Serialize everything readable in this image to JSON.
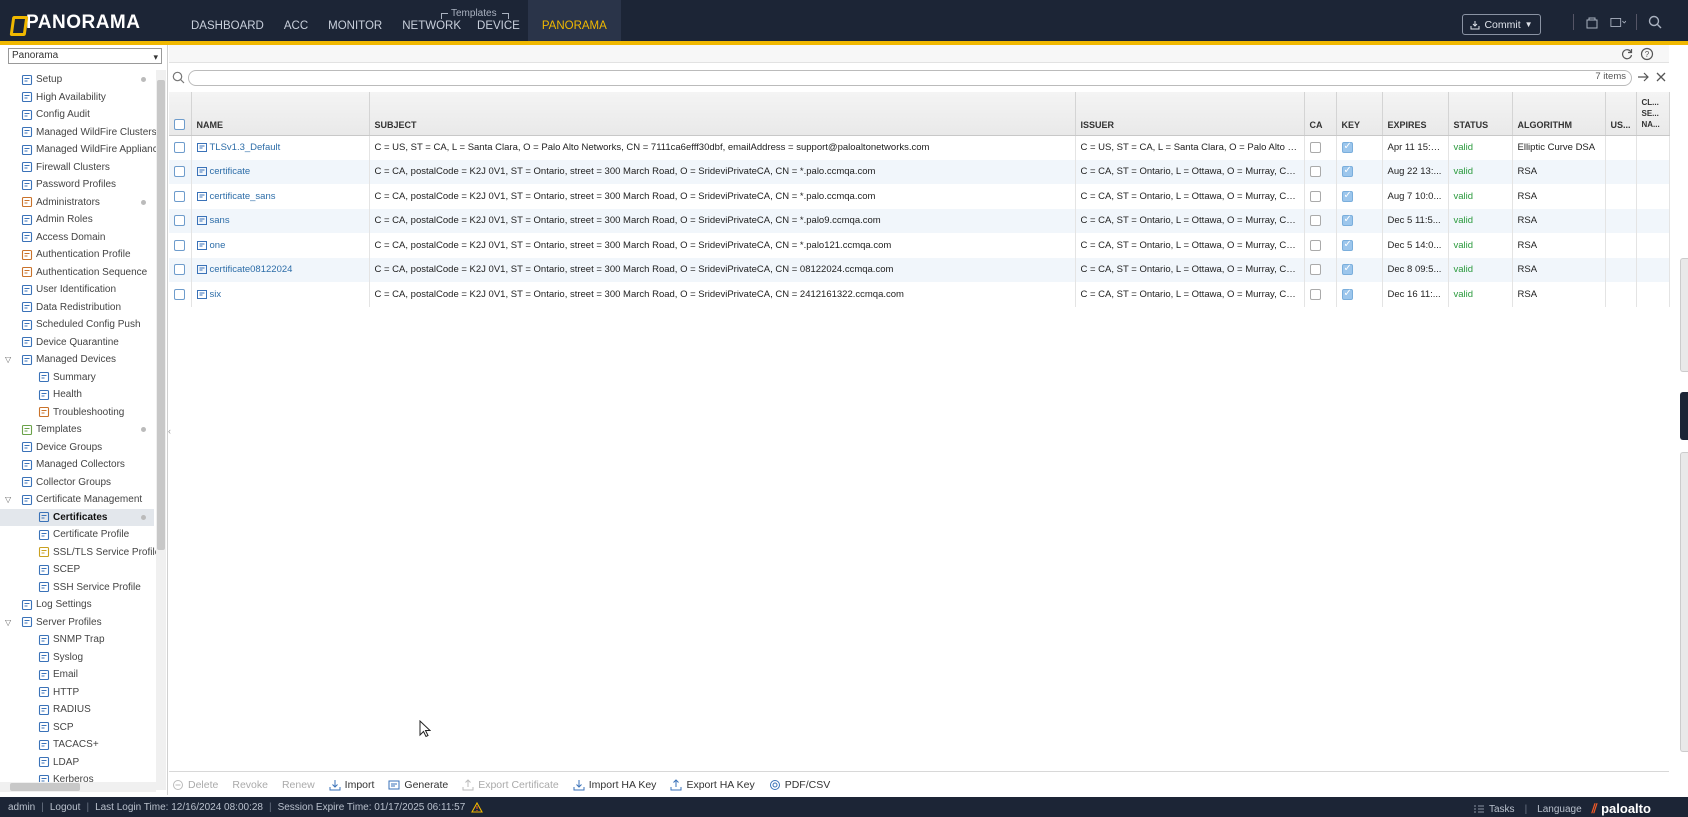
{
  "app": {
    "brand": "PANORAMA",
    "vendor": "paloalto"
  },
  "nav": {
    "tabs": [
      {
        "label": "DASHBOARD"
      },
      {
        "label": "ACC"
      },
      {
        "label": "MONITOR"
      },
      {
        "label": "NETWORK"
      },
      {
        "label": "DEVICE"
      },
      {
        "label": "PANORAMA"
      }
    ],
    "active_tab": "PANORAMA",
    "templates_group_label": "Templates",
    "commit_label": "Commit"
  },
  "context_select": {
    "value": "Panorama"
  },
  "sidebar": {
    "items": [
      {
        "label": "Setup",
        "icon": "setup-icon",
        "dot": true
      },
      {
        "label": "High Availability",
        "icon": "ha-icon"
      },
      {
        "label": "Config Audit",
        "icon": "audit-icon"
      },
      {
        "label": "Managed WildFire Clusters",
        "icon": "wildfire-icon"
      },
      {
        "label": "Managed WildFire Applianc",
        "icon": "wildfire-icon"
      },
      {
        "label": "Firewall Clusters",
        "icon": "cluster-icon"
      },
      {
        "label": "Password Profiles",
        "icon": "password-icon"
      },
      {
        "label": "Administrators",
        "icon": "admin-icon",
        "dot": true
      },
      {
        "label": "Admin Roles",
        "icon": "role-icon"
      },
      {
        "label": "Access Domain",
        "icon": "domain-icon"
      },
      {
        "label": "Authentication Profile",
        "icon": "auth-icon"
      },
      {
        "label": "Authentication Sequence",
        "icon": "auth-seq-icon"
      },
      {
        "label": "User Identification",
        "icon": "user-id-icon"
      },
      {
        "label": "Data Redistribution",
        "icon": "redistribution-icon"
      },
      {
        "label": "Scheduled Config Push",
        "icon": "schedule-icon"
      },
      {
        "label": "Device Quarantine",
        "icon": "quarantine-icon"
      },
      {
        "label": "Managed Devices",
        "icon": "devices-icon",
        "expander": true
      },
      {
        "label": "Summary",
        "icon": "summary-icon",
        "indent": 1
      },
      {
        "label": "Health",
        "icon": "health-icon",
        "indent": 1
      },
      {
        "label": "Troubleshooting",
        "icon": "troubleshoot-icon",
        "indent": 1
      },
      {
        "label": "Templates",
        "icon": "templates-icon",
        "dot": true
      },
      {
        "label": "Device Groups",
        "icon": "device-groups-icon"
      },
      {
        "label": "Managed Collectors",
        "icon": "collectors-icon"
      },
      {
        "label": "Collector Groups",
        "icon": "collector-groups-icon"
      },
      {
        "label": "Certificate Management",
        "icon": "cert-mgmt-icon",
        "expander": true
      },
      {
        "label": "Certificates",
        "icon": "certificate-icon",
        "indent": 1,
        "selected": true,
        "dot": true
      },
      {
        "label": "Certificate Profile",
        "icon": "cert-profile-icon",
        "indent": 1
      },
      {
        "label": "SSL/TLS Service Profile",
        "icon": "lock-icon",
        "indent": 1
      },
      {
        "label": "SCEP",
        "icon": "scep-icon",
        "indent": 1
      },
      {
        "label": "SSH Service Profile",
        "icon": "ssh-icon",
        "indent": 1
      },
      {
        "label": "Log Settings",
        "icon": "log-icon"
      },
      {
        "label": "Server Profiles",
        "icon": "server-icon",
        "expander": true
      },
      {
        "label": "SNMP Trap",
        "icon": "snmp-icon",
        "indent": 1
      },
      {
        "label": "Syslog",
        "icon": "syslog-icon",
        "indent": 1
      },
      {
        "label": "Email",
        "icon": "email-icon",
        "indent": 1
      },
      {
        "label": "HTTP",
        "icon": "http-icon",
        "indent": 1
      },
      {
        "label": "RADIUS",
        "icon": "radius-icon",
        "indent": 1
      },
      {
        "label": "SCP",
        "icon": "scp-icon",
        "indent": 1
      },
      {
        "label": "TACACS+",
        "icon": "tacacs-icon",
        "indent": 1
      },
      {
        "label": "LDAP",
        "icon": "ldap-icon",
        "indent": 1
      },
      {
        "label": "Kerberos",
        "icon": "kerberos-icon",
        "indent": 1
      }
    ]
  },
  "search": {
    "placeholder": "",
    "items_count": "7 items"
  },
  "table": {
    "columns": [
      "NAME",
      "SUBJECT",
      "ISSUER",
      "CA",
      "KEY",
      "EXPIRES",
      "STATUS",
      "ALGORITHM",
      "US...",
      "CL... SE... NA..."
    ],
    "rows": [
      {
        "name": "TLSv1.3_Default",
        "subject": "C = US, ST = CA, L = Santa Clara, O = Palo Alto Networks, CN = 7111ca6efff30dbf, emailAddress = support@paloaltonetworks.com",
        "issuer": "C = US, ST = CA, L = Santa Clara, O = Palo Alto Ne...",
        "ca": false,
        "key": true,
        "expires": "Apr 11 15:2...",
        "status": "valid",
        "algorithm": "Elliptic Curve DSA"
      },
      {
        "name": "certificate",
        "subject": "C = CA, postalCode = K2J 0V1, ST = Ontario, street = 300 March Road, O = SrideviPrivateCA, CN = *.palo.ccmqa.com",
        "issuer": "C = CA, ST = Ontario, L = Ottawa, O = Murray, CN ...",
        "ca": false,
        "key": true,
        "expires": "Aug 22 13:...",
        "status": "valid",
        "algorithm": "RSA"
      },
      {
        "name": "certificate_sans",
        "subject": "C = CA, postalCode = K2J 0V1, ST = Ontario, street = 300 March Road, O = SrideviPrivateCA, CN = *.palo.ccmqa.com",
        "issuer": "C = CA, ST = Ontario, L = Ottawa, O = Murray, CN ...",
        "ca": false,
        "key": true,
        "expires": "Aug 7 10:0...",
        "status": "valid",
        "algorithm": "RSA"
      },
      {
        "name": "sans",
        "subject": "C = CA, postalCode = K2J 0V1, ST = Ontario, street = 300 March Road, O = SrideviPrivateCA, CN = *.palo9.ccmqa.com",
        "issuer": "C = CA, ST = Ontario, L = Ottawa, O = Murray, CN ...",
        "ca": false,
        "key": true,
        "expires": "Dec 5 11:5...",
        "status": "valid",
        "algorithm": "RSA"
      },
      {
        "name": "one",
        "subject": "C = CA, postalCode = K2J 0V1, ST = Ontario, street = 300 March Road, O = SrideviPrivateCA, CN = *.palo121.ccmqa.com",
        "issuer": "C = CA, ST = Ontario, L = Ottawa, O = Murray, CN ...",
        "ca": false,
        "key": true,
        "expires": "Dec 5 14:0...",
        "status": "valid",
        "algorithm": "RSA"
      },
      {
        "name": "certificate08122024",
        "subject": "C = CA, postalCode = K2J 0V1, ST = Ontario, street = 300 March Road, O = SrideviPrivateCA, CN = 08122024.ccmqa.com",
        "issuer": "C = CA, ST = Ontario, L = Ottawa, O = Murray, CN ...",
        "ca": false,
        "key": true,
        "expires": "Dec 8 09:5...",
        "status": "valid",
        "algorithm": "RSA"
      },
      {
        "name": "six",
        "subject": "C = CA, postalCode = K2J 0V1, ST = Ontario, street = 300 March Road, O = SrideviPrivateCA, CN = 2412161322.ccmqa.com",
        "issuer": "C = CA, ST = Ontario, L = Ottawa, O = Murray, CN ...",
        "ca": false,
        "key": true,
        "expires": "Dec 16 11:...",
        "status": "valid",
        "algorithm": "RSA"
      }
    ]
  },
  "actions": [
    {
      "label": "Delete",
      "icon": "delete-icon",
      "enabled": false
    },
    {
      "label": "Revoke",
      "icon": "",
      "enabled": false
    },
    {
      "label": "Renew",
      "icon": "",
      "enabled": false
    },
    {
      "label": "Import",
      "icon": "import-icon",
      "enabled": true
    },
    {
      "label": "Generate",
      "icon": "generate-icon",
      "enabled": true
    },
    {
      "label": "Export Certificate",
      "icon": "export-icon",
      "enabled": false
    },
    {
      "label": "Import HA Key",
      "icon": "import-icon",
      "enabled": true
    },
    {
      "label": "Export HA Key",
      "icon": "export-icon",
      "enabled": true
    },
    {
      "label": "PDF/CSV",
      "icon": "pdf-csv-icon",
      "enabled": true
    }
  ],
  "statusbar": {
    "user": "admin",
    "logout": "Logout",
    "last_login": "Last Login Time: 12/16/2024 08:00:28",
    "session_expire": "Session Expire Time: 01/17/2025 06:11:57",
    "tasks": "Tasks",
    "language": "Language",
    "brand": "paloalto"
  },
  "colors": {
    "topbar": "#1c2536",
    "accent": "#f0b800",
    "link": "#2d6da8",
    "valid": "#2a9a3c",
    "brand_slash": "#f05a28"
  }
}
